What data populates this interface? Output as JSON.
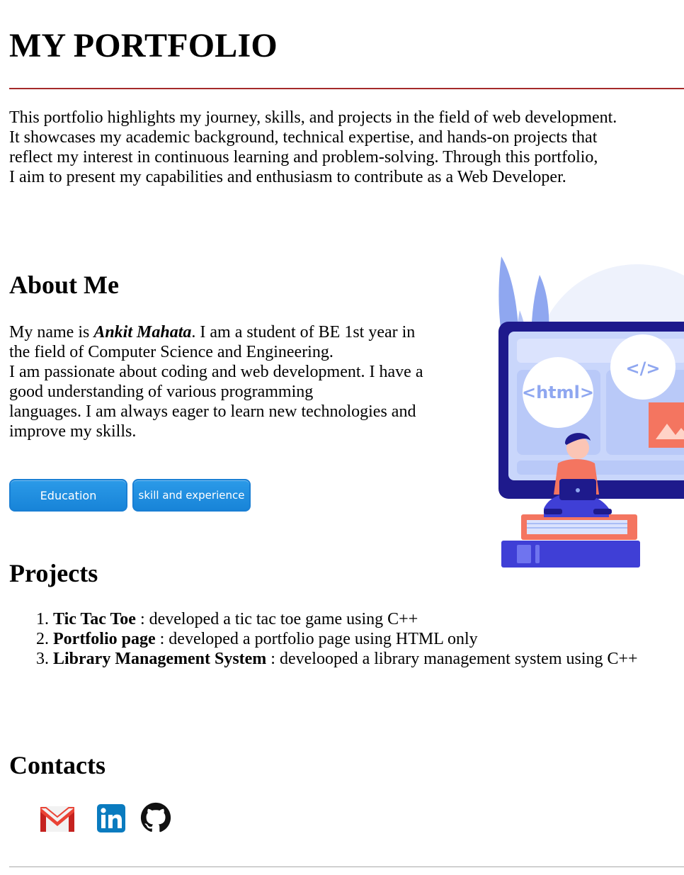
{
  "header": {
    "title": "MY PORTFOLIO"
  },
  "intro": {
    "lines": [
      "This portfolio highlights my journey, skills, and projects in the field of web development.",
      "It showcases my academic background, technical expertise, and hands-on projects that",
      "reflect my interest in continuous learning and problem-solving. Through this portfolio,",
      "I aim to present my capabilities and enthusiasm to contribute as a Web Developer."
    ]
  },
  "about": {
    "heading": "About Me",
    "line1_prefix": "My name is ",
    "name": "Ankit Mahata",
    "line1_suffix": ". I am a student of BE 1st year in",
    "lines": [
      "the field of Computer Science and Engineering.",
      "I am passionate about coding and web development. I have a",
      "good understanding of various programming",
      "languages. I am always eager to learn new technologies and",
      "improve my skills."
    ],
    "buttons": {
      "education": "Education",
      "skills": "skill and experience"
    },
    "illustration": {
      "html_label": "<html>",
      "code_label": "</>",
      "colors": {
        "monitor": "#1e1a8c",
        "panel": "#a9bdf5",
        "accent": "#f47560",
        "leaf": "#8fa7f0",
        "books": "#3f3fd6"
      }
    }
  },
  "projects": {
    "heading": "Projects",
    "items": [
      {
        "title": "Tic Tac Toe",
        "desc": " : developed a tic tac toe game using C++"
      },
      {
        "title": "Portfolio page",
        "desc": " : developed a portfolio page using HTML only"
      },
      {
        "title": "Library Management System",
        "desc": " : develooped a library management system using C++"
      }
    ]
  },
  "contacts": {
    "heading": "Contacts",
    "icons": [
      "gmail-icon",
      "linkedin-icon",
      "github-icon"
    ],
    "colors": {
      "gmail_red": "#ea4335",
      "linkedin_blue": "#0a7bbf",
      "github_black": "#111111"
    }
  }
}
